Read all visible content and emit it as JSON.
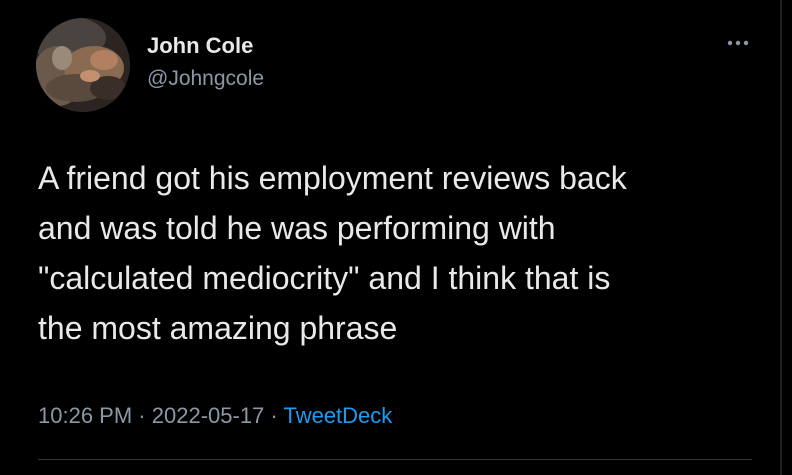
{
  "tweet": {
    "author": {
      "display_name": "John Cole",
      "handle": "@Johngcole",
      "avatar": "cat-avatar-photo"
    },
    "more_icon": "more-horizontal-icon",
    "text": "A friend got his employment reviews back\nand was told he was performing with\n\"calculated mediocrity\" and I think that is\nthe most amazing phrase",
    "time": "10:26 PM",
    "separator": "·",
    "date": "2022-05-17",
    "source": "TweetDeck"
  },
  "colors": {
    "background": "#000000",
    "text_primary": "#e7e9ea",
    "text_secondary": "#8b98a5",
    "link": "#1d9bf0",
    "divider": "#2f3336"
  }
}
